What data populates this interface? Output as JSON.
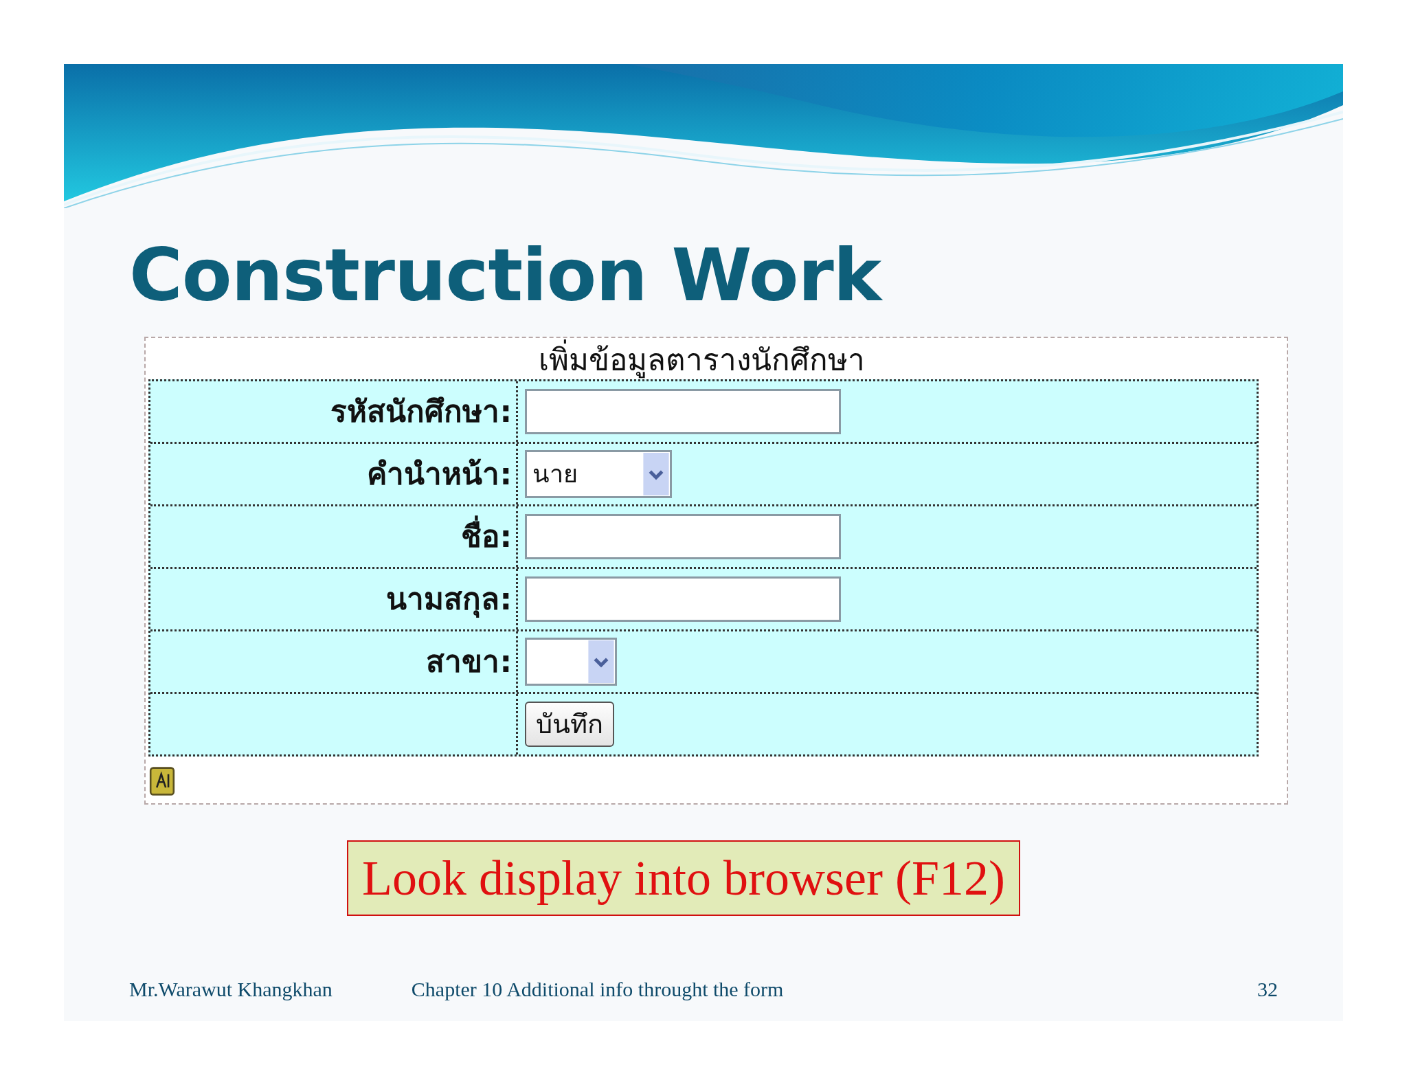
{
  "title": "Construction Work",
  "form": {
    "heading": "เพิ่มข้อมูลตารางนักศึกษา",
    "fields": [
      {
        "label": "รหัสนักศึกษา:",
        "kind": "text"
      },
      {
        "label": "คำนำหน้า:",
        "kind": "select",
        "value": "นาย"
      },
      {
        "label": "ชื่อ:",
        "kind": "text"
      },
      {
        "label": "นามสกุล:",
        "kind": "text"
      },
      {
        "label": "สาขา:",
        "kind": "select"
      }
    ],
    "submit": "บันทึก"
  },
  "callout": "Look display into browser (F12)",
  "footer": {
    "author": "Mr.Warawut  Khangkhan",
    "chapter": "Chapter 10 Additional info throught the form",
    "page": "32"
  }
}
